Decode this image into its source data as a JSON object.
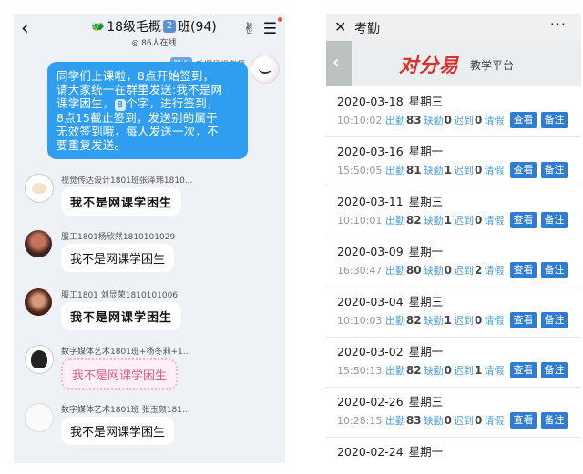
{
  "chat": {
    "back_glyph": "‹",
    "title": "18级毛概",
    "title_num": "2",
    "title_suffix": "班(94)",
    "online": "86人在线",
    "teacher": {
      "role": "群主",
      "name": "毛概侯帆老师"
    },
    "announcement": [
      "同学们上课啦，8点开始签到，",
      "请大家统一在群里发送:我不是网",
      "课学困生，",
      "8",
      "个字，进行签到，",
      "8点15截止签到，发送别的属于",
      "无效签到哦，每人发送一次，不",
      "要重复发送。"
    ],
    "messages": [
      {
        "name": "视觉传达设计1801班张泽玮1810...",
        "text": "我不是网课学困生"
      },
      {
        "name": "服工1801杨欣然1810101029",
        "text": "我不是网课学困生"
      },
      {
        "name": "服工1801 刘显荣1810101006",
        "text": "我不是网课学困生"
      },
      {
        "name": "数字媒体艺术1801班+杨冬莉+1...",
        "text": "我不是网课学困生"
      },
      {
        "name": "数字媒体艺术1801班 张玉颜181...",
        "text": "我不是网课学困生"
      }
    ]
  },
  "attendance": {
    "title": "考勤",
    "close_glyph": "✕",
    "more_glyph": "···",
    "banner_back": "‹",
    "logo": "对分易",
    "platform": "教学平台",
    "labels": {
      "present": "出勤",
      "absent": "缺勤",
      "late": "迟到",
      "leave": "请假",
      "view": "查看",
      "note": "备注"
    },
    "records": [
      {
        "date": "2020-03-18",
        "weekday": "星期三",
        "time": "10:10:02",
        "present": "83",
        "absent": "0",
        "late": "0"
      },
      {
        "date": "2020-03-16",
        "weekday": "星期一",
        "time": "15:50:05",
        "present": "81",
        "absent": "1",
        "late": "0"
      },
      {
        "date": "2020-03-11",
        "weekday": "星期三",
        "time": "10:10:01",
        "present": "82",
        "absent": "1",
        "late": "0"
      },
      {
        "date": "2020-03-09",
        "weekday": "星期一",
        "time": "16:30:47",
        "present": "80",
        "absent": "0",
        "late": "2"
      },
      {
        "date": "2020-03-04",
        "weekday": "星期三",
        "time": "10:10:03",
        "present": "82",
        "absent": "1",
        "late": "0"
      },
      {
        "date": "2020-03-02",
        "weekday": "星期一",
        "time": "15:50:13",
        "present": "82",
        "absent": "0",
        "late": "1"
      },
      {
        "date": "2020-02-26",
        "weekday": "星期三",
        "time": "10:28:15",
        "present": "83",
        "absent": "0",
        "late": "0"
      },
      {
        "date": "2020-02-24",
        "weekday": "星期一",
        "time": "",
        "present": "",
        "absent": "",
        "late": ""
      }
    ]
  }
}
